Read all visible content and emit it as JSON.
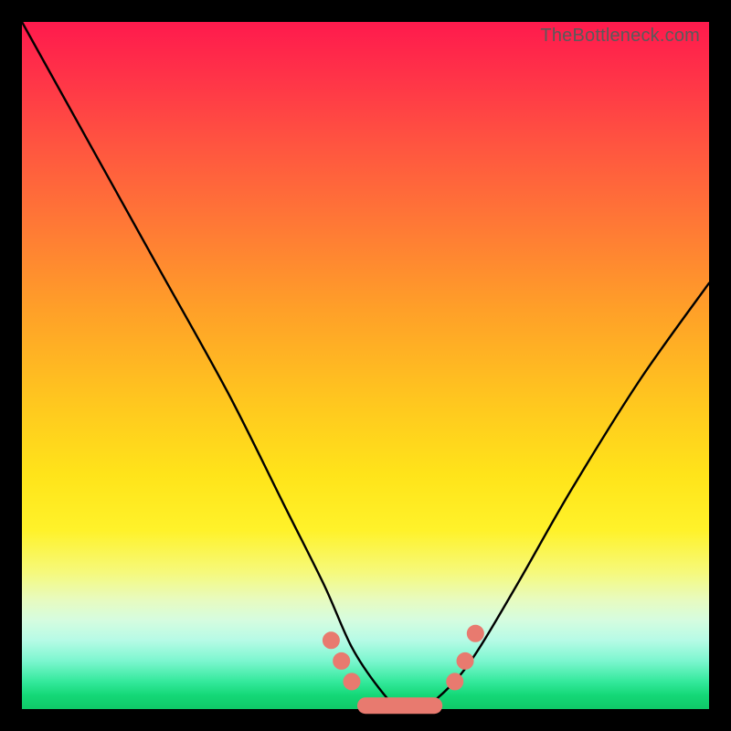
{
  "watermark": "TheBottleneck.com",
  "colors": {
    "frame": "#000000",
    "curve": "#000000",
    "markers": "#e87a6f",
    "gradient_top": "#ff1a4d",
    "gradient_bottom": "#0fc968"
  },
  "chart_data": {
    "type": "line",
    "title": "",
    "xlabel": "",
    "ylabel": "",
    "xlim": [
      0,
      100
    ],
    "ylim": [
      0,
      100
    ],
    "grid": false,
    "legend": false,
    "annotations": [
      "TheBottleneck.com"
    ],
    "series": [
      {
        "name": "bottleneck-curve",
        "x": [
          0,
          10,
          20,
          30,
          38,
          44,
          48,
          52,
          55,
          58,
          62,
          66,
          72,
          80,
          90,
          100
        ],
        "y": [
          100,
          82,
          64,
          46,
          30,
          18,
          9,
          3,
          0,
          0,
          3,
          8,
          18,
          32,
          48,
          62
        ]
      }
    ],
    "markers": {
      "left_cluster": [
        [
          45,
          10
        ],
        [
          46.5,
          7
        ],
        [
          48,
          4
        ]
      ],
      "right_cluster": [
        [
          63,
          4
        ],
        [
          64.5,
          7
        ],
        [
          66,
          11
        ]
      ],
      "flat_segment": {
        "x0": 50,
        "x1": 60,
        "y": 0.5
      }
    },
    "notes": "V-shaped bottleneck curve over a vertical rainbow gradient from red (top, high bottleneck) to green (bottom, low bottleneck). Salmon-colored markers and a short flat salmon band sit near the curve's trough. No numeric axes or tick labels are visible; the background gradient conveys the y-axis scale qualitatively."
  }
}
